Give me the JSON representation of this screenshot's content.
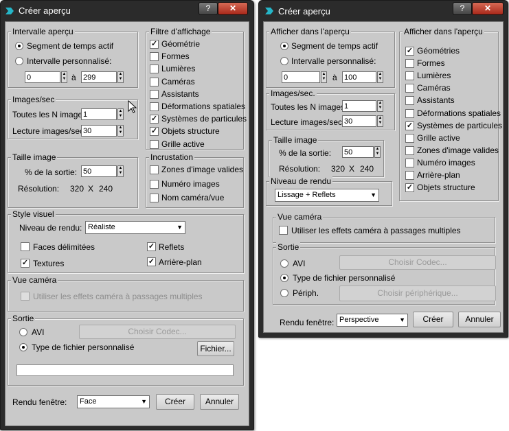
{
  "left": {
    "title": "Créer aperçu",
    "caption_help": "?",
    "caption_close": "✕",
    "range_group": "Intervalle aperçu",
    "range_active": "Segment de temps actif",
    "range_custom": "Intervalle personnalisé:",
    "range_from": "0",
    "range_to_label": "à",
    "range_to": "299",
    "images_group": "Images/sec",
    "every_n_label": "Toutes les N images:",
    "every_n_value": "1",
    "playback_label": "Lecture images/sec:",
    "playback_value": "30",
    "size_group": "Taille image",
    "percent_label": "% de la sortie:",
    "percent_value": "50",
    "resolution_label": "Résolution:",
    "res_w": "320",
    "res_x": "X",
    "res_h": "240",
    "filter_group": "Filtre d'affichage",
    "filter_items": [
      "Géométrie",
      "Formes",
      "Lumières",
      "Caméras",
      "Assistants",
      "Déformations spatiales",
      "Systèmes de particules",
      "Objets structure",
      "Grille active"
    ],
    "overlay_group": "Incrustation",
    "overlay_items": [
      "Zones d'image valides",
      "Numéro images",
      "Nom caméra/vue"
    ],
    "visual_group": "Style visuel",
    "render_level_label": "Niveau de rendu:",
    "render_level_value": "Réaliste",
    "faces_label": "Faces délimitées",
    "reflets_label": "Reflets",
    "textures_label": "Textures",
    "background_label": "Arrière-plan",
    "camera_group": "Vue caméra",
    "camera_multipass": "Utiliser les effets caméra à passages multiples",
    "output_group": "Sortie",
    "avi_label": "AVI",
    "codec_button": "Choisir Codec...",
    "custom_type_label": "Type de fichier personnalisé",
    "file_button": "Fichier...",
    "viewport_label": "Rendu fenêtre:",
    "viewport_value": "Face",
    "create_button": "Créer",
    "cancel_button": "Annuler"
  },
  "right": {
    "title": "Créer aperçu",
    "caption_help": "?",
    "caption_close": "✕",
    "show_group": "Afficher dans l'aperçu",
    "range_active": "Segment de temps actif",
    "range_custom": "Intervalle personnalisé:",
    "range_from": "0",
    "range_to_label": "à",
    "range_to": "100",
    "images_group": "Images/sec.",
    "every_n_label": "Toutes les N images:",
    "every_n_value": "1",
    "playback_label": "Lecture images/sec:",
    "playback_value": "30",
    "size_group": "Taille image",
    "percent_label": "% de la sortie:",
    "percent_value": "50",
    "resolution_label": "Résolution:",
    "res_w": "320",
    "res_x": "X",
    "res_h": "240",
    "render_group": "Niveau de rendu",
    "render_level_value": "Lissage + Reflets",
    "show_group2": "Afficher dans l'aperçu",
    "show_items": [
      "Géométries",
      "Formes",
      "Lumières",
      "Caméras",
      "Assistants",
      "Déformations spatiales",
      "Systèmes de particules",
      "Grille active",
      "Zones d'image valides",
      "Numéro images",
      "Arrière-plan",
      "Objets structure"
    ],
    "camera_group": "Vue caméra",
    "camera_multipass": "Utiliser les effets caméra à passages multiples",
    "output_group": "Sortie",
    "avi_label": "AVI",
    "codec_button": "Choisir Codec...",
    "custom_type_label": "Type de fichier personnalisé",
    "device_label": "Périph.",
    "device_button": "Choisir périphérique...",
    "viewport_label": "Rendu fenêtre:",
    "viewport_value": "Perspective",
    "create_button": "Créer",
    "cancel_button": "Annuler"
  },
  "checks": {
    "left_filter": [
      true,
      false,
      false,
      false,
      false,
      false,
      true,
      true,
      false
    ],
    "left_overlay": [
      false,
      false,
      false
    ],
    "right_show": [
      true,
      false,
      false,
      false,
      false,
      false,
      true,
      false,
      false,
      false,
      false,
      true
    ]
  },
  "check_mark": "✓",
  "icon_names": [
    "app-icon",
    "help-icon",
    "close-icon",
    "spinner-arrows-icon",
    "dropdown-arrow-icon",
    "mouse-cursor-icon"
  ]
}
